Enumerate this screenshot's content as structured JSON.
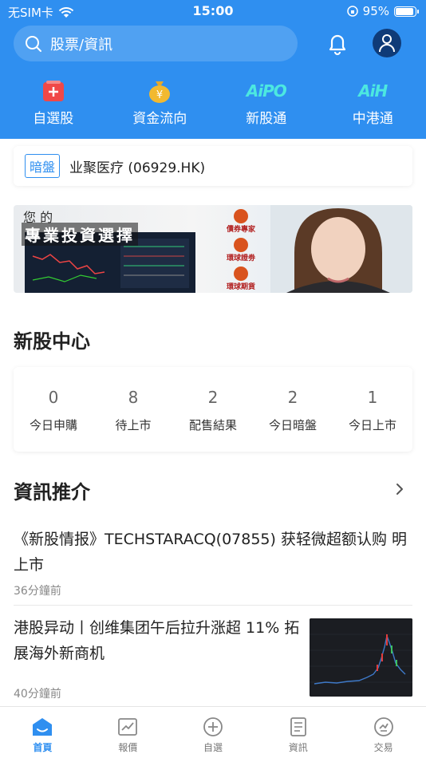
{
  "status_bar": {
    "carrier": "无SIM卡",
    "time": "15:00",
    "battery": "95%"
  },
  "search": {
    "placeholder": "股票/資訊"
  },
  "quick_nav": [
    {
      "label": "自選股",
      "icon": "plus-square-icon"
    },
    {
      "label": "資金流向",
      "icon": "money-bag-icon"
    },
    {
      "label": "新股通",
      "icon": "aipo-icon",
      "icon_text": "AiPO"
    },
    {
      "label": "中港通",
      "icon": "aih-icon",
      "icon_text": "AiH"
    }
  ],
  "dark_pool": {
    "badge": "暗盤",
    "stock": "业聚医疗 (06929.HK)"
  },
  "banner": {
    "line1": "您 的",
    "line2": "專業投資選擇",
    "logos": [
      "債券專家",
      "環球證劵",
      "環球期貨"
    ]
  },
  "ipo_center": {
    "title": "新股中心",
    "stats": [
      {
        "value": "0",
        "label": "今日申購"
      },
      {
        "value": "8",
        "label": "待上市"
      },
      {
        "value": "2",
        "label": "配售結果"
      },
      {
        "value": "2",
        "label": "今日暗盤"
      },
      {
        "value": "1",
        "label": "今日上市"
      }
    ]
  },
  "news": {
    "title": "資訊推介",
    "items": [
      {
        "title": "《新股情报》TECHSTARACQ(07855) 获轻微超额认购 明上市",
        "time": "36分鐘前"
      },
      {
        "title": "港股异动丨创维集团午后拉升涨超 11% 拓展海外新商机",
        "time": "40分鐘前"
      }
    ]
  },
  "tabs": [
    {
      "label": "首頁",
      "icon": "home-icon",
      "active": true
    },
    {
      "label": "報價",
      "icon": "chart-icon",
      "active": false
    },
    {
      "label": "自選",
      "icon": "plus-circle-icon",
      "active": false
    },
    {
      "label": "資訊",
      "icon": "document-icon",
      "active": false
    },
    {
      "label": "交易",
      "icon": "trade-icon",
      "active": false
    }
  ],
  "colors": {
    "primary": "#2f8ff0",
    "header_bg": "#2f8ff0"
  }
}
